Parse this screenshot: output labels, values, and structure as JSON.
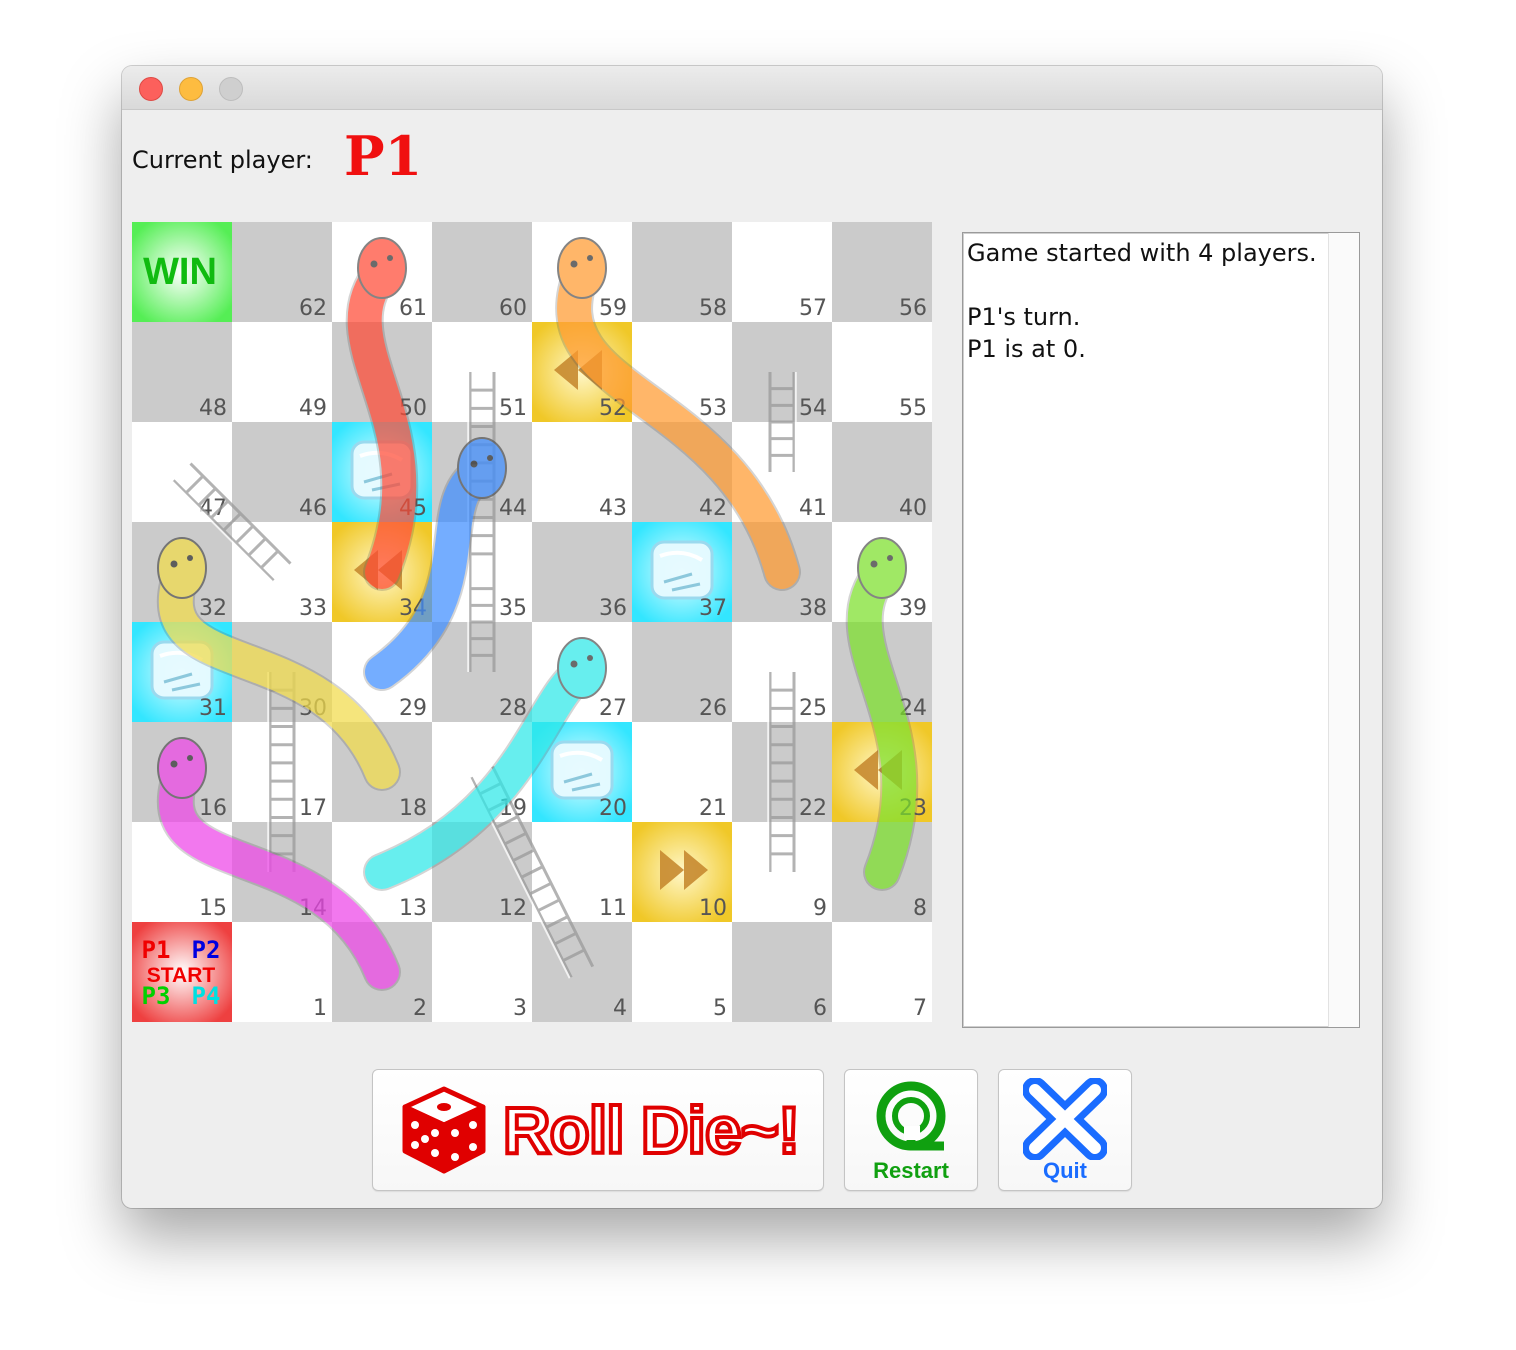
{
  "header": {
    "current_player_label": "Current player:",
    "current_player": "P1",
    "current_player_color": "#f01010"
  },
  "board": {
    "win_label": "WIN",
    "start_label": "START",
    "start_players": [
      "P1",
      "P2",
      "P3",
      "P4"
    ],
    "start_player_colors": [
      "#f00000",
      "#0000e0",
      "#00d000",
      "#00e0e0"
    ],
    "rows": [
      [
        null,
        62,
        61,
        60,
        59,
        58,
        57,
        56
      ],
      [
        48,
        49,
        50,
        51,
        52,
        53,
        54,
        55
      ],
      [
        47,
        46,
        45,
        44,
        43,
        42,
        41,
        40
      ],
      [
        32,
        33,
        34,
        35,
        36,
        37,
        38,
        39
      ],
      [
        31,
        30,
        29,
        28,
        27,
        26,
        25,
        24
      ],
      [
        16,
        17,
        18,
        19,
        20,
        21,
        22,
        23
      ],
      [
        15,
        14,
        13,
        12,
        11,
        10,
        9,
        8
      ],
      [
        null,
        1,
        2,
        3,
        4,
        5,
        6,
        7
      ]
    ],
    "special_cells": [
      {
        "cell": 52,
        "kind": "back",
        "icon": "rewind-icon"
      },
      {
        "cell": 34,
        "kind": "back",
        "icon": "rewind-icon"
      },
      {
        "cell": 23,
        "kind": "back",
        "icon": "rewind-icon"
      },
      {
        "cell": 10,
        "kind": "forward",
        "icon": "fast-forward-icon"
      },
      {
        "cell": 45,
        "kind": "freeze",
        "icon": "ice-cube-icon"
      },
      {
        "cell": 37,
        "kind": "freeze",
        "icon": "ice-cube-icon"
      },
      {
        "cell": 31,
        "kind": "freeze",
        "icon": "ice-cube-icon"
      },
      {
        "cell": 20,
        "kind": "freeze",
        "icon": "ice-cube-icon"
      }
    ],
    "ladders": [
      {
        "from": 30,
        "to": 14
      },
      {
        "from": 51,
        "to": 35
      },
      {
        "from": 47,
        "to": 33
      },
      {
        "from": 35,
        "to": 28
      },
      {
        "from": 41,
        "to": 54
      },
      {
        "from": 25,
        "to": 9
      },
      {
        "from": 19,
        "to": 4
      }
    ],
    "snakes": [
      {
        "head": 61,
        "tail": 34,
        "color": "#ff4a35"
      },
      {
        "head": 59,
        "tail": 38,
        "color": "#ff9a30"
      },
      {
        "head": 44,
        "tail": 29,
        "color": "#3f8eff"
      },
      {
        "head": 32,
        "tail": 18,
        "color": "#f2dc4a"
      },
      {
        "head": 16,
        "tail": 2,
        "color": "#ee45e8"
      },
      {
        "head": 27,
        "tail": 13,
        "color": "#2ee8e8"
      },
      {
        "head": 39,
        "tail": 8,
        "color": "#7ce02a"
      }
    ]
  },
  "log": {
    "lines": [
      "Game started with 4 players.",
      "",
      "P1's turn.",
      "P1 is at 0."
    ]
  },
  "buttons": {
    "roll_label": "Roll Die~!",
    "restart_label": "Restart",
    "quit_label": "Quit",
    "roll_color": "#e00000",
    "restart_color": "#10a010",
    "quit_color": "#1a6cff"
  }
}
